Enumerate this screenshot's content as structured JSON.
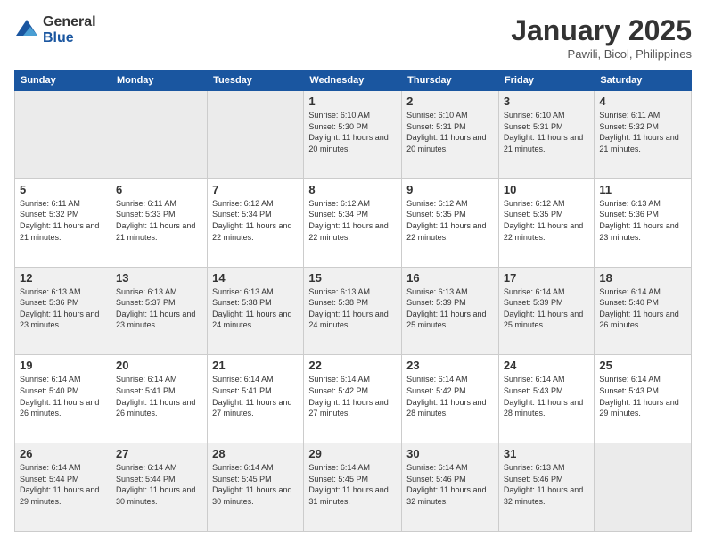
{
  "logo": {
    "general": "General",
    "blue": "Blue"
  },
  "header": {
    "month": "January 2025",
    "location": "Pawili, Bicol, Philippines"
  },
  "weekdays": [
    "Sunday",
    "Monday",
    "Tuesday",
    "Wednesday",
    "Thursday",
    "Friday",
    "Saturday"
  ],
  "weeks": [
    [
      {
        "day": "",
        "info": ""
      },
      {
        "day": "",
        "info": ""
      },
      {
        "day": "",
        "info": ""
      },
      {
        "day": "1",
        "info": "Sunrise: 6:10 AM\nSunset: 5:30 PM\nDaylight: 11 hours and 20 minutes."
      },
      {
        "day": "2",
        "info": "Sunrise: 6:10 AM\nSunset: 5:31 PM\nDaylight: 11 hours and 20 minutes."
      },
      {
        "day": "3",
        "info": "Sunrise: 6:10 AM\nSunset: 5:31 PM\nDaylight: 11 hours and 21 minutes."
      },
      {
        "day": "4",
        "info": "Sunrise: 6:11 AM\nSunset: 5:32 PM\nDaylight: 11 hours and 21 minutes."
      }
    ],
    [
      {
        "day": "5",
        "info": "Sunrise: 6:11 AM\nSunset: 5:32 PM\nDaylight: 11 hours and 21 minutes."
      },
      {
        "day": "6",
        "info": "Sunrise: 6:11 AM\nSunset: 5:33 PM\nDaylight: 11 hours and 21 minutes."
      },
      {
        "day": "7",
        "info": "Sunrise: 6:12 AM\nSunset: 5:34 PM\nDaylight: 11 hours and 22 minutes."
      },
      {
        "day": "8",
        "info": "Sunrise: 6:12 AM\nSunset: 5:34 PM\nDaylight: 11 hours and 22 minutes."
      },
      {
        "day": "9",
        "info": "Sunrise: 6:12 AM\nSunset: 5:35 PM\nDaylight: 11 hours and 22 minutes."
      },
      {
        "day": "10",
        "info": "Sunrise: 6:12 AM\nSunset: 5:35 PM\nDaylight: 11 hours and 22 minutes."
      },
      {
        "day": "11",
        "info": "Sunrise: 6:13 AM\nSunset: 5:36 PM\nDaylight: 11 hours and 23 minutes."
      }
    ],
    [
      {
        "day": "12",
        "info": "Sunrise: 6:13 AM\nSunset: 5:36 PM\nDaylight: 11 hours and 23 minutes."
      },
      {
        "day": "13",
        "info": "Sunrise: 6:13 AM\nSunset: 5:37 PM\nDaylight: 11 hours and 23 minutes."
      },
      {
        "day": "14",
        "info": "Sunrise: 6:13 AM\nSunset: 5:38 PM\nDaylight: 11 hours and 24 minutes."
      },
      {
        "day": "15",
        "info": "Sunrise: 6:13 AM\nSunset: 5:38 PM\nDaylight: 11 hours and 24 minutes."
      },
      {
        "day": "16",
        "info": "Sunrise: 6:13 AM\nSunset: 5:39 PM\nDaylight: 11 hours and 25 minutes."
      },
      {
        "day": "17",
        "info": "Sunrise: 6:14 AM\nSunset: 5:39 PM\nDaylight: 11 hours and 25 minutes."
      },
      {
        "day": "18",
        "info": "Sunrise: 6:14 AM\nSunset: 5:40 PM\nDaylight: 11 hours and 26 minutes."
      }
    ],
    [
      {
        "day": "19",
        "info": "Sunrise: 6:14 AM\nSunset: 5:40 PM\nDaylight: 11 hours and 26 minutes."
      },
      {
        "day": "20",
        "info": "Sunrise: 6:14 AM\nSunset: 5:41 PM\nDaylight: 11 hours and 26 minutes."
      },
      {
        "day": "21",
        "info": "Sunrise: 6:14 AM\nSunset: 5:41 PM\nDaylight: 11 hours and 27 minutes."
      },
      {
        "day": "22",
        "info": "Sunrise: 6:14 AM\nSunset: 5:42 PM\nDaylight: 11 hours and 27 minutes."
      },
      {
        "day": "23",
        "info": "Sunrise: 6:14 AM\nSunset: 5:42 PM\nDaylight: 11 hours and 28 minutes."
      },
      {
        "day": "24",
        "info": "Sunrise: 6:14 AM\nSunset: 5:43 PM\nDaylight: 11 hours and 28 minutes."
      },
      {
        "day": "25",
        "info": "Sunrise: 6:14 AM\nSunset: 5:43 PM\nDaylight: 11 hours and 29 minutes."
      }
    ],
    [
      {
        "day": "26",
        "info": "Sunrise: 6:14 AM\nSunset: 5:44 PM\nDaylight: 11 hours and 29 minutes."
      },
      {
        "day": "27",
        "info": "Sunrise: 6:14 AM\nSunset: 5:44 PM\nDaylight: 11 hours and 30 minutes."
      },
      {
        "day": "28",
        "info": "Sunrise: 6:14 AM\nSunset: 5:45 PM\nDaylight: 11 hours and 30 minutes."
      },
      {
        "day": "29",
        "info": "Sunrise: 6:14 AM\nSunset: 5:45 PM\nDaylight: 11 hours and 31 minutes."
      },
      {
        "day": "30",
        "info": "Sunrise: 6:14 AM\nSunset: 5:46 PM\nDaylight: 11 hours and 32 minutes."
      },
      {
        "day": "31",
        "info": "Sunrise: 6:13 AM\nSunset: 5:46 PM\nDaylight: 11 hours and 32 minutes."
      },
      {
        "day": "",
        "info": ""
      }
    ]
  ]
}
